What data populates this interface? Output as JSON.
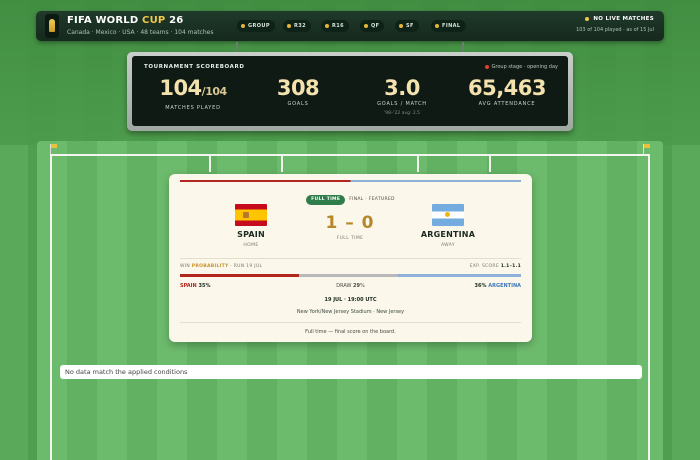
{
  "header": {
    "title_main": "FIFA WORLD ",
    "title_accent": "CUP",
    "title_year": " 26",
    "subtitle": "Canada · Mexico · USA  ·  48 teams  ·  104 matches",
    "stages": [
      "GROUP",
      "R32",
      "R16",
      "QF",
      "SF",
      "FINAL"
    ],
    "live_label": "NO LIVE MATCHES",
    "live_sub": "103 of 104 played · as of 15 Jul"
  },
  "scoreboard": {
    "title": "TOURNAMENT SCOREBOARD",
    "status": "Group stage · opening day",
    "stats": [
      {
        "value": "104",
        "suffix": "/104",
        "label": "MATCHES PLAYED",
        "note": ""
      },
      {
        "value": "308",
        "suffix": "",
        "label": "GOALS",
        "note": ""
      },
      {
        "value": "3.0",
        "suffix": "",
        "label": "GOALS / MATCH",
        "note": "'98–'22 avg: 2.5"
      },
      {
        "value": "65,463",
        "suffix": "",
        "label": "AVG ATTENDANCE",
        "note": ""
      }
    ]
  },
  "match": {
    "status_pill": "FULL TIME",
    "tag": "FINAL · FEATURED",
    "home": {
      "name": "SPAIN",
      "role": "HOME",
      "flag": "flag-spain"
    },
    "away": {
      "name": "ARGENTINA",
      "role": "AWAY",
      "flag": "flag-argentina"
    },
    "score": "1 – 0",
    "score_label": "FULL TIME",
    "prob_head_prefix": "WIN ",
    "prob_head_highlight": "PROBABILITY",
    "prob_head_suffix": " · RUN 19 JUL",
    "exp_label": "EXP. SCORE ",
    "exp_value": "1.1–1.1",
    "probabilities": {
      "home": 35,
      "draw": 29,
      "away": 36
    },
    "prob_home_team": "SPAIN",
    "prob_home_pct": "35",
    "prob_draw_label": "DRAW",
    "prob_draw_pct": "29",
    "prob_away_team": "ARGENTINA",
    "prob_away_pct": "36",
    "pct_sign": "%",
    "kickoff": "19 JUL · 19:00 UTC",
    "venue": "New York/New Jersey Stadium · New Jersey",
    "final_note": "Full time — final score on the board.",
    "colors": {
      "home": "#b3261e",
      "draw": "#b8b8b8",
      "away": "#8fb0d9",
      "accent": "#c8922c"
    }
  },
  "empty_state": "No data match the applied conditions"
}
